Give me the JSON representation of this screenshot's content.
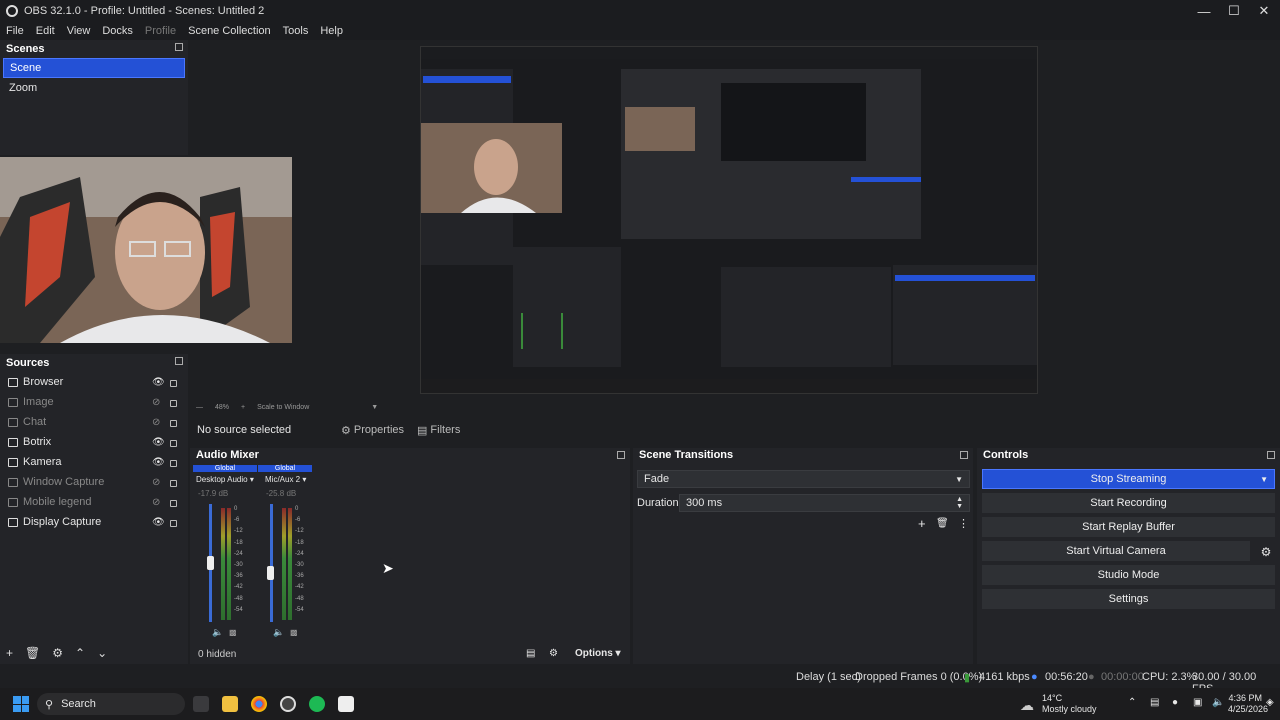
{
  "window": {
    "title": "OBS 32.1.0 - Profile: Untitled - Scenes: Untitled 2"
  },
  "menu": [
    "File",
    "Edit",
    "View",
    "Docks",
    "Profile",
    "Scene Collection",
    "Tools",
    "Help"
  ],
  "scenes": {
    "title": "Scenes",
    "items": [
      "Scene",
      "Zoom"
    ],
    "selected": "Scene"
  },
  "sources": {
    "title": "Sources",
    "items": [
      {
        "label": "Browser",
        "visible": true
      },
      {
        "label": "Image",
        "visible": false
      },
      {
        "label": "Chat",
        "visible": false
      },
      {
        "label": "Botrix",
        "visible": true
      },
      {
        "label": "Kamera",
        "visible": true
      },
      {
        "label": "Window Capture",
        "visible": false
      },
      {
        "label": "Mobile legend",
        "visible": false
      },
      {
        "label": "Display Capture",
        "visible": true
      }
    ]
  },
  "preview_bar": {
    "zoom": "48%",
    "scale": "Scale to Window"
  },
  "context": {
    "no_source": "No source selected",
    "properties": "Properties",
    "filters": "Filters"
  },
  "mixer": {
    "title": "Audio Mixer",
    "channels": [
      {
        "badge": "Global",
        "name": "Desktop Audio",
        "db": "-17.9 dB",
        "level": 0.57
      },
      {
        "badge": "Global",
        "name": "Mic/Aux 2",
        "db": "-25.8 dB",
        "level": 0.45
      }
    ],
    "scale": [
      "0",
      "-6",
      "-12",
      "-18",
      "-24",
      "-30",
      "-36",
      "-42",
      "-48",
      "-54",
      "-60"
    ],
    "hidden": "0 hidden",
    "options": "Options"
  },
  "transitions": {
    "title": "Scene Transitions",
    "type": "Fade",
    "duration_label": "Duration",
    "duration": "300 ms"
  },
  "controls": {
    "title": "Controls",
    "buttons": [
      "Stop Streaming",
      "Start Recording",
      "Start Replay Buffer",
      "Start Virtual Camera",
      "Studio Mode",
      "Settings"
    ]
  },
  "status": {
    "delay": "Delay (1 sec)",
    "dropped": "Dropped Frames 0 (0.0%)",
    "bitrate": "4161 kbps",
    "stream_time": "00:56:20",
    "rec_time": "00:00:00",
    "cpu": "CPU: 2.3%",
    "fps": "30.00 / 30.00 FPS"
  },
  "taskbar": {
    "search": "Search",
    "weather_temp": "14°C",
    "weather_desc": "Mostly cloudy",
    "time": "4:36 PM",
    "date": "4/25/2026"
  },
  "colors": {
    "accent": "#2451d6",
    "panel": "#232428",
    "bg": "#1e1f22"
  }
}
